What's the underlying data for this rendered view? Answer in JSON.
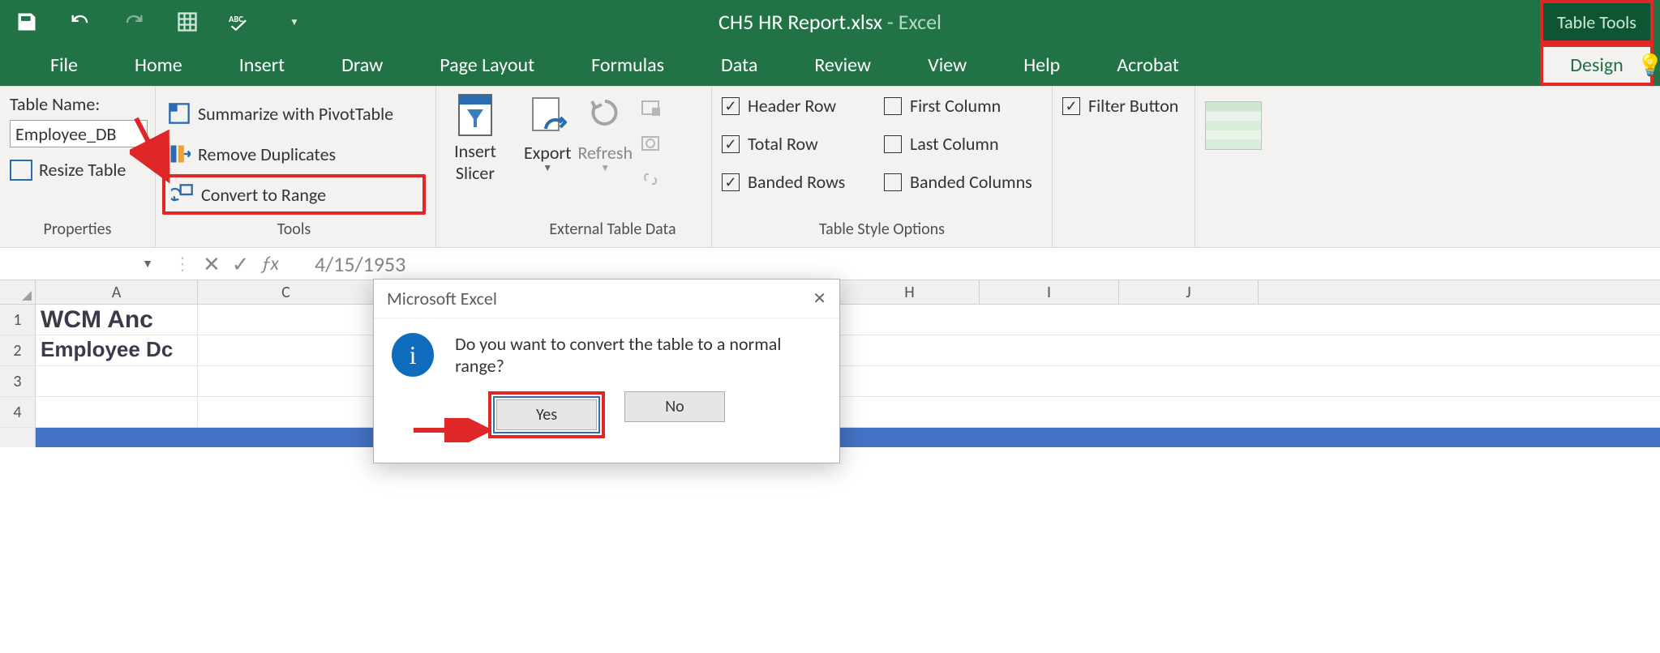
{
  "titlebar": {
    "document": "CH5 HR Report.xlsx",
    "separator": "  -  ",
    "app": "Excel",
    "table_tools": "Table Tools"
  },
  "tabs": {
    "file": "File",
    "home": "Home",
    "insert": "Insert",
    "draw": "Draw",
    "page_layout": "Page Layout",
    "formulas": "Formulas",
    "data": "Data",
    "review": "Review",
    "view": "View",
    "help": "Help",
    "acrobat": "Acrobat",
    "design": "Design",
    "tell_me": "T"
  },
  "ribbon": {
    "properties": {
      "table_name_label": "Table Name:",
      "table_name_value": "Employee_DB",
      "resize": "Resize Table",
      "group_label": "Properties"
    },
    "tools": {
      "pivot": "Summarize with PivotTable",
      "dupes": "Remove Duplicates",
      "convert": "Convert to Range",
      "group_label": "Tools"
    },
    "slicer": {
      "label_line1": "Insert",
      "label_line2": "Slicer"
    },
    "external": {
      "export": "Export",
      "refresh": "Refresh",
      "group_label": "External Table Data"
    },
    "options": {
      "header_row": "Header Row",
      "total_row": "Total Row",
      "banded_rows": "Banded Rows",
      "first_col": "First Column",
      "last_col": "Last Column",
      "banded_cols": "Banded Columns",
      "filter_button": "Filter Button",
      "group_label": "Table Style Options",
      "state": {
        "header_row": true,
        "total_row": true,
        "banded_rows": true,
        "first_col": false,
        "last_col": false,
        "banded_cols": false,
        "filter_button": true
      }
    }
  },
  "formula_bar": {
    "value_preview": "4/15/1953"
  },
  "sheet": {
    "columns": [
      "A",
      "C",
      "H",
      "I",
      "J"
    ],
    "row1_cellA": "WCM Anc",
    "row2_cellA": "Employee Dc"
  },
  "dialog": {
    "title": "Microsoft Excel",
    "message": "Do you want to convert the table to a normal range?",
    "yes": "Yes",
    "no": "No"
  },
  "annotations": {
    "arrow_color": "#e02727"
  }
}
